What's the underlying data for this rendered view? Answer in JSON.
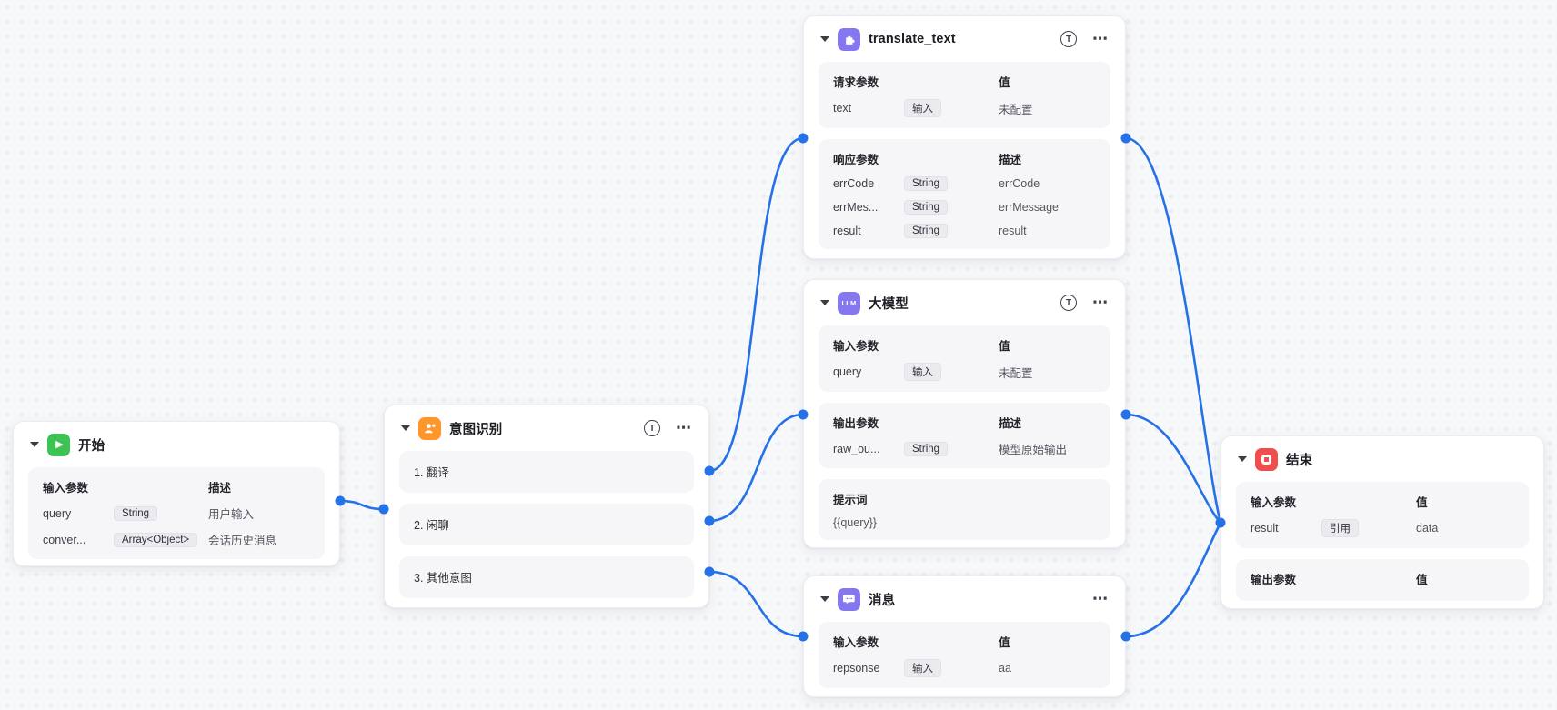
{
  "canvas": {
    "background": "#f7f8f9",
    "grid_color": "#e9ebf2",
    "edge_color": "#2471e8"
  },
  "header_icons": {
    "run_label": "T",
    "more_label": "⋯"
  },
  "edges": [
    {
      "from": "开始",
      "to": "意图识别"
    },
    {
      "from": "意图识别: 1. 翻译",
      "to": "translate_text"
    },
    {
      "from": "意图识别: 2. 闲聊",
      "to": "大模型"
    },
    {
      "from": "意图识别: 3. 其他意图",
      "to": "消息"
    },
    {
      "from": "translate_text",
      "to": "结束"
    },
    {
      "from": "大模型",
      "to": "结束"
    },
    {
      "from": "消息",
      "to": "结束"
    }
  ],
  "nodes": {
    "start": {
      "title": "开始",
      "icon": "play-icon",
      "icon_color": "#3dc353",
      "params": {
        "header_left": "输入参数",
        "header_right": "描述",
        "rows": [
          {
            "name": "query",
            "badge": "String",
            "value": "用户输入"
          },
          {
            "name": "conver...",
            "badge": "Array<Object>",
            "value": "会话历史消息"
          }
        ]
      }
    },
    "intent": {
      "title": "意图识别",
      "icon": "user-icon",
      "icon_color": "#ff9629",
      "branches": [
        {
          "label": "1. 翻译"
        },
        {
          "label": "2. 闲聊"
        },
        {
          "label": "3. 其他意图"
        }
      ]
    },
    "translate": {
      "title": "translate_text",
      "icon": "plugin-icon",
      "icon_color": "#8577f0",
      "request": {
        "header_left": "请求参数",
        "header_right": "值",
        "rows": [
          {
            "name": "text",
            "badge": "输入",
            "value": "未配置"
          }
        ]
      },
      "response": {
        "header_left": "响应参数",
        "header_right": "描述",
        "rows": [
          {
            "name": "errCode",
            "badge": "String",
            "value": "errCode"
          },
          {
            "name": "errMes...",
            "badge": "String",
            "value": "errMessage"
          },
          {
            "name": "result",
            "badge": "String",
            "value": "result"
          }
        ]
      }
    },
    "llm": {
      "title": "大模型",
      "icon": "llm-icon",
      "icon_text": "LLM",
      "icon_color": "#8577f0",
      "input": {
        "header_left": "输入参数",
        "header_right": "值",
        "rows": [
          {
            "name": "query",
            "badge": "输入",
            "value": "未配置"
          }
        ]
      },
      "output": {
        "header_left": "输出参数",
        "header_right": "描述",
        "rows": [
          {
            "name": "raw_ou...",
            "badge": "String",
            "value": "模型原始输出"
          }
        ]
      },
      "prompt": {
        "header": "提示词",
        "value": "{{query}}"
      }
    },
    "message": {
      "title": "消息",
      "icon": "chat-icon",
      "icon_color": "#8577f0",
      "input": {
        "header_left": "输入参数",
        "header_right": "值",
        "rows": [
          {
            "name": "repsonse",
            "badge": "输入",
            "value": "aa"
          }
        ]
      }
    },
    "end": {
      "title": "结束",
      "icon": "stop-icon",
      "icon_color": "#ee4e4e",
      "input": {
        "header_left": "输入参数",
        "header_right": "值",
        "rows": [
          {
            "name": "result",
            "badge": "引用",
            "value": "data"
          }
        ]
      },
      "output": {
        "header_left": "输出参数",
        "header_right": "值"
      }
    }
  }
}
